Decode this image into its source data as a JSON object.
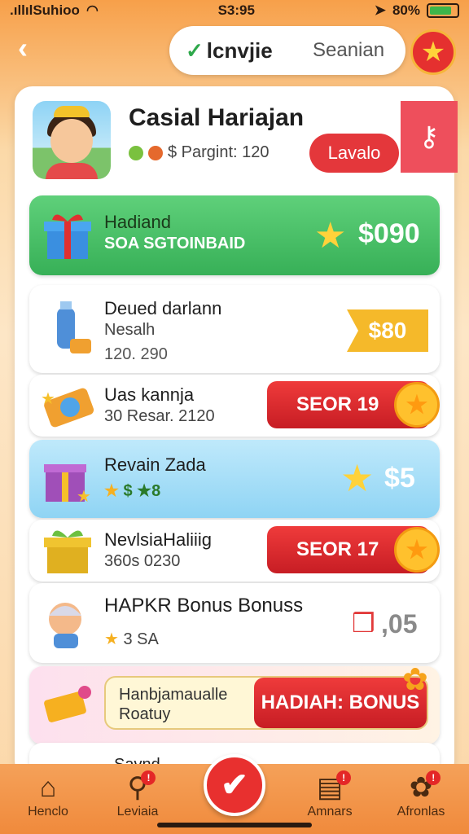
{
  "status": {
    "carrier": ".ıllılSuhioo",
    "time": "S3:95",
    "battery": "80%"
  },
  "header": {
    "tab_active": "lcnvjie",
    "tab_other": "Seanian"
  },
  "profile": {
    "name": "Casial Hariajan",
    "stat": "$ Pargint: 120",
    "level_button": "Lavalo"
  },
  "rows": {
    "r1": {
      "title": "Hadiand",
      "subtitle": "SOA SGTOINBAID",
      "amount": "$090"
    },
    "r2": {
      "title": "Deued darlann",
      "subtitle": "Nesalh",
      "meta": "120. 290",
      "price": "$80"
    },
    "r3": {
      "title": "Uas kannja",
      "subtitle": "30 Resar. 2120",
      "button": "SEOR 19"
    },
    "r4": {
      "title": "Revain Zada",
      "subtitle": "$ ★8",
      "amount": "$5"
    },
    "r5": {
      "title": "NevlsiaHaliiig",
      "subtitle": "360s 0230",
      "button": "SEOR 17"
    },
    "r6": {
      "title": "HAPKR Bonus Bonuss",
      "subtitle": "3 SA",
      "amount": ",05"
    },
    "r7": {
      "line1": "Hanbjamaualle",
      "line2": "Roatuy",
      "button": "HADIAH: BONUS"
    },
    "r8": {
      "title": "Savnd"
    }
  },
  "nav": {
    "items": [
      {
        "label": "Henclo",
        "icon": "home-icon"
      },
      {
        "label": "Leviaia",
        "icon": "search-icon"
      },
      {
        "label": "Amnars",
        "icon": "inbox-icon"
      },
      {
        "label": "Afronlas",
        "icon": "settings-icon"
      }
    ]
  },
  "colors": {
    "accent_red": "#e4373b",
    "header_orange": "#f7a04a",
    "green": "#37b057",
    "blue": "#8fd4f4"
  }
}
